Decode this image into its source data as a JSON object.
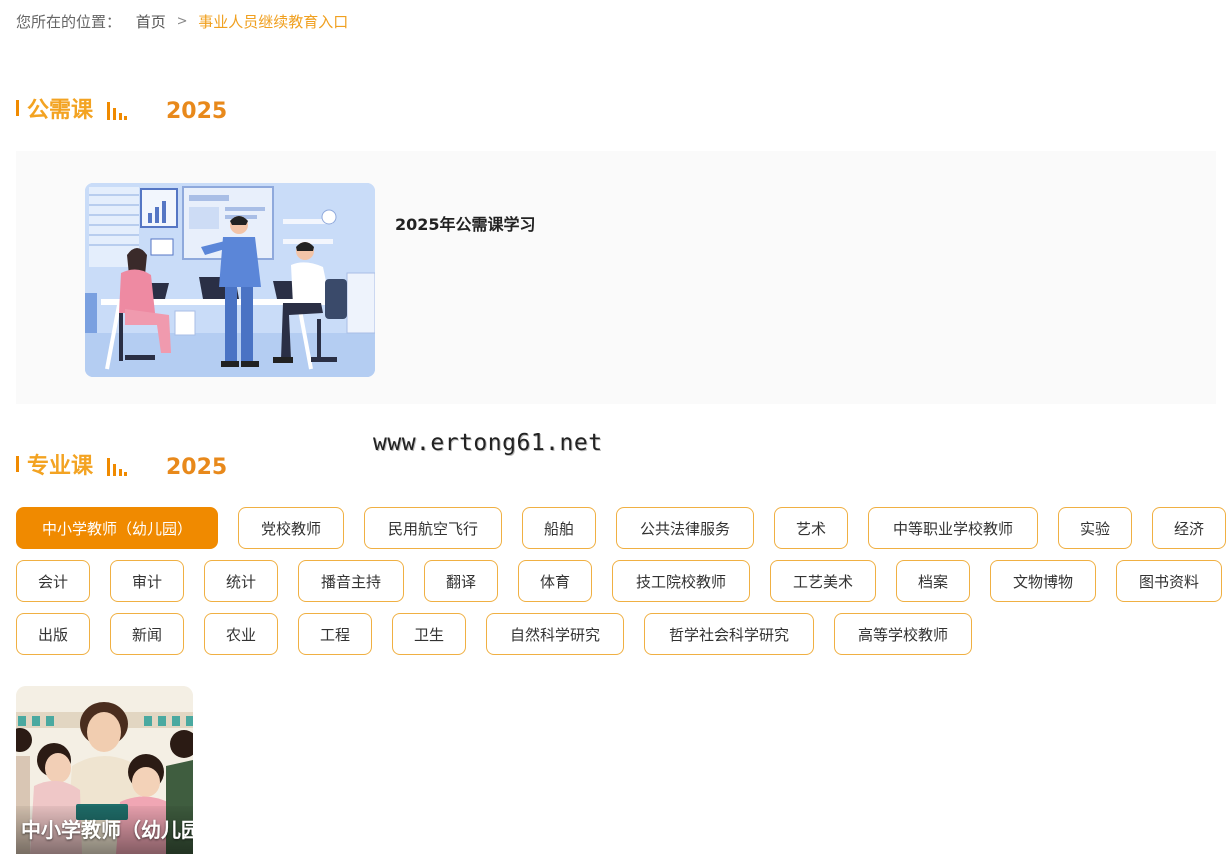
{
  "breadcrumb": {
    "prefix": "您所在的位置：",
    "home": "首页",
    "separator": ">",
    "current": "事业人员继续教育入口"
  },
  "public_section": {
    "title": "公需课",
    "year": "2025",
    "items": [
      {
        "title": "2025年公需课学习"
      }
    ]
  },
  "watermark": "www.ertong61.net",
  "professional_section": {
    "title": "专业课",
    "year": "2025",
    "active_tag": "中小学教师（幼儿园）",
    "tags": [
      "中小学教师（幼儿园）",
      "党校教师",
      "民用航空飞行",
      "船舶",
      "公共法律服务",
      "艺术",
      "中等职业学校教师",
      "实验",
      "经济",
      "会计",
      "审计",
      "统计",
      "播音主持",
      "翻译",
      "体育",
      "技工院校教师",
      "工艺美术",
      "档案",
      "文物博物",
      "图书资料",
      "出版",
      "新闻",
      "农业",
      "工程",
      "卫生",
      "自然科学研究",
      "哲学社会科学研究",
      "高等学校教师"
    ],
    "courses": [
      {
        "title": "中小学教师（幼儿园）"
      }
    ]
  },
  "colors": {
    "accent": "#f08a00",
    "heading": "#f3a322",
    "tag_border": "#f0b043"
  }
}
